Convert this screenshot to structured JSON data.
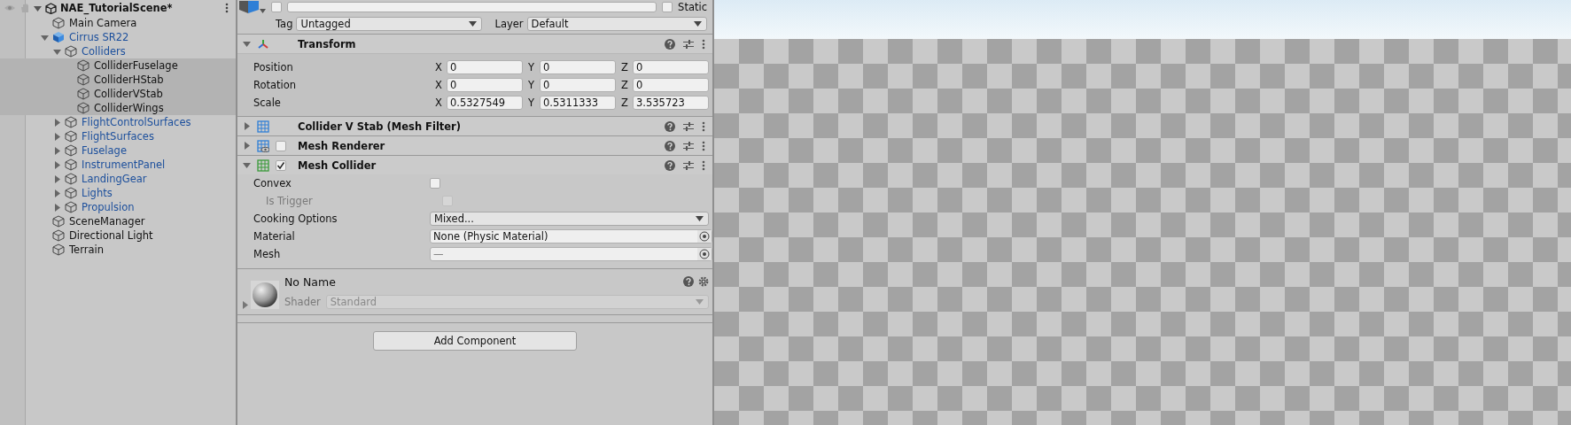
{
  "hierarchy": {
    "scene": {
      "name": "NAE_TutorialScene*"
    },
    "items": [
      {
        "name": "Main Camera",
        "kind": "object",
        "selected": false
      },
      {
        "name": "Cirrus SR22",
        "kind": "prefab_root",
        "selected": false,
        "expanded": true,
        "children": [
          {
            "name": "Colliders",
            "kind": "prefab_child",
            "selected": false,
            "expanded": true,
            "children": [
              {
                "name": "ColliderFuselage",
                "kind": "object",
                "selected": true
              },
              {
                "name": "ColliderHStab",
                "kind": "object",
                "selected": true
              },
              {
                "name": "ColliderVStab",
                "kind": "object",
                "selected": true
              },
              {
                "name": "ColliderWings",
                "kind": "object",
                "selected": true
              }
            ]
          },
          {
            "name": "FlightControlSurfaces",
            "kind": "prefab_child",
            "selected": false,
            "expanded": false
          },
          {
            "name": "FlightSurfaces",
            "kind": "prefab_child",
            "selected": false,
            "expanded": false
          },
          {
            "name": "Fuselage",
            "kind": "prefab_child",
            "selected": false,
            "expanded": false
          },
          {
            "name": "InstrumentPanel",
            "kind": "prefab_child",
            "selected": false,
            "expanded": false
          },
          {
            "name": "LandingGear",
            "kind": "prefab_child",
            "selected": false,
            "expanded": false
          },
          {
            "name": "Lights",
            "kind": "prefab_child",
            "selected": false,
            "expanded": false
          },
          {
            "name": "Propulsion",
            "kind": "prefab_child",
            "selected": false,
            "expanded": false
          }
        ]
      },
      {
        "name": "SceneManager",
        "kind": "object",
        "selected": false
      },
      {
        "name": "Directional Light",
        "kind": "object",
        "selected": false
      },
      {
        "name": "Terrain",
        "kind": "object",
        "selected": false
      }
    ]
  },
  "inspector": {
    "active": {
      "checked": false
    },
    "static": {
      "label": "Static",
      "checked": false
    },
    "tag": {
      "label": "Tag",
      "value": "Untagged"
    },
    "layer": {
      "label": "Layer",
      "value": "Default"
    },
    "components": [
      {
        "kind": "transform",
        "title": "Transform",
        "expanded": true,
        "rows": [
          {
            "label": "Position",
            "fields": [
              {
                "axis": "X",
                "value": "0"
              },
              {
                "axis": "Y",
                "value": "0"
              },
              {
                "axis": "Z",
                "value": "0"
              }
            ]
          },
          {
            "label": "Rotation",
            "fields": [
              {
                "axis": "X",
                "value": "0"
              },
              {
                "axis": "Y",
                "value": "0"
              },
              {
                "axis": "Z",
                "value": "0"
              }
            ]
          },
          {
            "label": "Scale",
            "fields": [
              {
                "axis": "X",
                "value": "0.5327549"
              },
              {
                "axis": "Y",
                "value": "0.5311333"
              },
              {
                "axis": "Z",
                "value": "3.535723"
              }
            ]
          }
        ]
      },
      {
        "kind": "mesh_filter",
        "title": "Collider V Stab (Mesh Filter)",
        "expanded": false
      },
      {
        "kind": "mesh_renderer",
        "title": "Mesh Renderer",
        "expanded": false,
        "enabled": false
      },
      {
        "kind": "mesh_collider",
        "title": "Mesh Collider",
        "expanded": true,
        "enabled": true,
        "properties": [
          {
            "kind": "checkbox",
            "label": "Convex",
            "checked": false,
            "disabled": false,
            "children": [
              {
                "kind": "checkbox",
                "label": "Is Trigger",
                "checked": false,
                "disabled": true
              }
            ]
          },
          {
            "kind": "dropdown",
            "label": "Cooking Options",
            "value": "Mixed..."
          },
          {
            "kind": "object",
            "label": "Material",
            "value": "None (Physic Material)",
            "mixed": false
          },
          {
            "kind": "object",
            "label": "Mesh",
            "value": "—",
            "mixed": true
          }
        ]
      },
      {
        "kind": "material",
        "name": "No Name",
        "shader_label": "Shader",
        "shader": "Standard",
        "expanded": false
      }
    ],
    "add_button": {
      "label": "Add Component"
    }
  }
}
